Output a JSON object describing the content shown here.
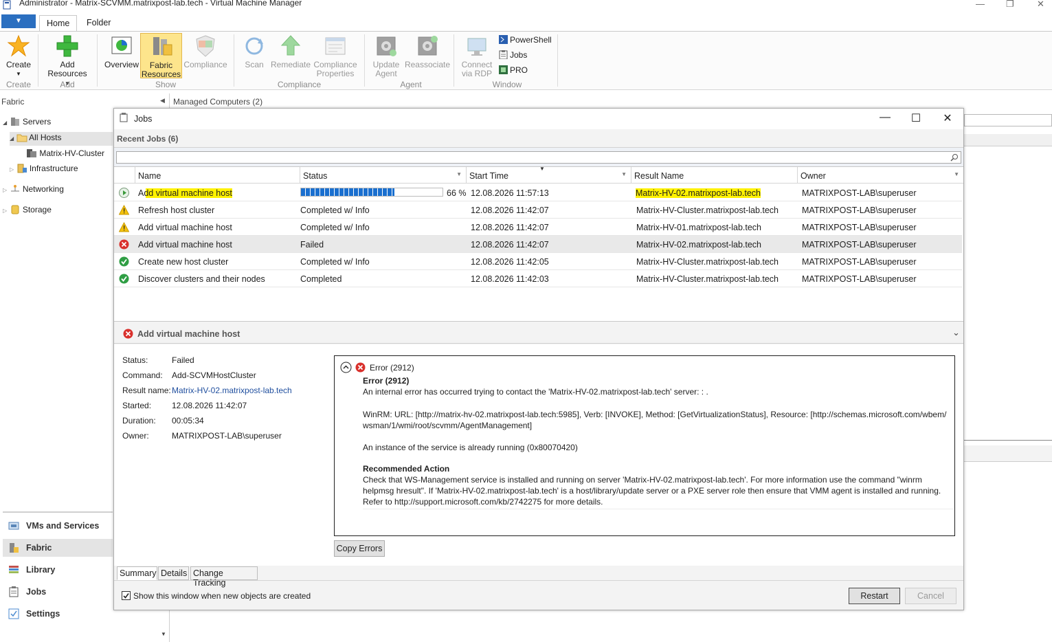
{
  "window": {
    "title": "Administrator - Matrix-SCVMM.matrixpost-lab.tech - Virtual Machine Manager"
  },
  "ribbon": {
    "tabs": [
      "Home",
      "Folder"
    ],
    "buttons": {
      "create": "Create",
      "add_resources_1": "Add",
      "add_resources_2": "Resources",
      "overview": "Overview",
      "fabric_resources_1": "Fabric",
      "fabric_resources_2": "Resources",
      "compliance": "Compliance",
      "scan": "Scan",
      "remediate": "Remediate",
      "compliance_properties_1": "Compliance",
      "compliance_properties_2": "Properties",
      "update_agent_1": "Update",
      "update_agent_2": "Agent",
      "reassociate": "Reassociate",
      "connect_rdp_1": "Connect",
      "connect_rdp_2": "via RDP",
      "powershell": "PowerShell",
      "jobs": "Jobs",
      "pro": "PRO"
    },
    "groups": {
      "create": "Create",
      "add": "Add",
      "show": "Show",
      "compliance": "Compliance",
      "agent": "Agent",
      "window": "Window"
    }
  },
  "left": {
    "header": "Fabric",
    "tree": {
      "servers": "Servers",
      "all_hosts": "All Hosts",
      "cluster": "Matrix-HV-Cluster",
      "infrastructure": "Infrastructure",
      "networking": "Networking",
      "storage": "Storage"
    },
    "nav": [
      "VMs and Services",
      "Fabric",
      "Library",
      "Jobs",
      "Settings"
    ]
  },
  "main": {
    "header": "Managed Computers (2)"
  },
  "jobs_window": {
    "title": "Jobs",
    "recent_label": "Recent Jobs (6)",
    "columns": [
      "Name",
      "Status",
      "Start Time",
      "Result Name",
      "Owner"
    ],
    "rows": [
      {
        "name": "Add virtual machine host",
        "status": "66 %",
        "progress": 0.66,
        "start": "12.08.2026 11:57:13",
        "result": "Matrix-HV-02.matrixpost-lab.tech",
        "owner": "MATRIXPOST-LAB\\superuser",
        "state": "running"
      },
      {
        "name": "Refresh host cluster",
        "status": "Completed w/ Info",
        "start": "12.08.2026 11:42:07",
        "result": "Matrix-HV-Cluster.matrixpost-lab.tech",
        "owner": "MATRIXPOST-LAB\\superuser",
        "state": "warning"
      },
      {
        "name": "Add virtual machine host",
        "status": "Completed w/ Info",
        "start": "12.08.2026 11:42:07",
        "result": "Matrix-HV-01.matrixpost-lab.tech",
        "owner": "MATRIXPOST-LAB\\superuser",
        "state": "warning"
      },
      {
        "name": "Add virtual machine host",
        "status": "Failed",
        "start": "12.08.2026 11:42:07",
        "result": "Matrix-HV-02.matrixpost-lab.tech",
        "owner": "MATRIXPOST-LAB\\superuser",
        "state": "failed"
      },
      {
        "name": "Create new host cluster",
        "status": "Completed w/ Info",
        "start": "12.08.2026 11:42:05",
        "result": "Matrix-HV-Cluster.matrixpost-lab.tech",
        "owner": "MATRIXPOST-LAB\\superuser",
        "state": "ok"
      },
      {
        "name": "Discover clusters and their nodes",
        "status": "Completed",
        "start": "12.08.2026 11:42:03",
        "result": "Matrix-HV-Cluster.matrixpost-lab.tech",
        "owner": "MATRIXPOST-LAB\\superuser",
        "state": "ok"
      }
    ],
    "detail": {
      "header": "Add virtual machine host",
      "labels": {
        "status": "Status:",
        "command": "Command:",
        "result": "Result name:",
        "started": "Started:",
        "duration": "Duration:",
        "owner": "Owner:"
      },
      "values": {
        "status": "Failed",
        "command": "Add-SCVMHostCluster",
        "result": "Matrix-HV-02.matrixpost-lab.tech",
        "started": "12.08.2026 11:42:07",
        "duration": "00:05:34",
        "owner": "MATRIXPOST-LAB\\superuser"
      },
      "error": {
        "summary": "Error (2912)",
        "title": "Error (2912)",
        "line1": "An internal error has occurred trying to contact the 'Matrix-HV-02.matrixpost-lab.tech' server: : .",
        "winrm1": "WinRM: URL: [http://matrix-hv-02.matrixpost-lab.tech:5985], Verb: [INVOKE], Method: [GetVirtualizationStatus], Resource: [http://schemas.microsoft.com/wbem/",
        "winrm2": "wsman/1/wmi/root/scvmm/AgentManagement]",
        "instance": "An instance of the service is already running (0x80070420)",
        "rec_title": "Recommended Action",
        "rec1": "Check that WS-Management service is installed and running on server 'Matrix-HV-02.matrixpost-lab.tech'. For more information use the command \"winrm",
        "rec2": "helpmsg hresult\". If 'Matrix-HV-02.matrixpost-lab.tech' is a host/library/update server or a PXE server role then ensure that VMM agent is installed and running.",
        "rec3": "Refer to http://support.microsoft.com/kb/2742275 for more details."
      },
      "copy_errors": "Copy Errors"
    },
    "tabs": [
      "Summary",
      "Details",
      "Change Tracking"
    ],
    "show_window_label": "Show this window when new objects are created",
    "restart": "Restart",
    "cancel": "Cancel"
  }
}
